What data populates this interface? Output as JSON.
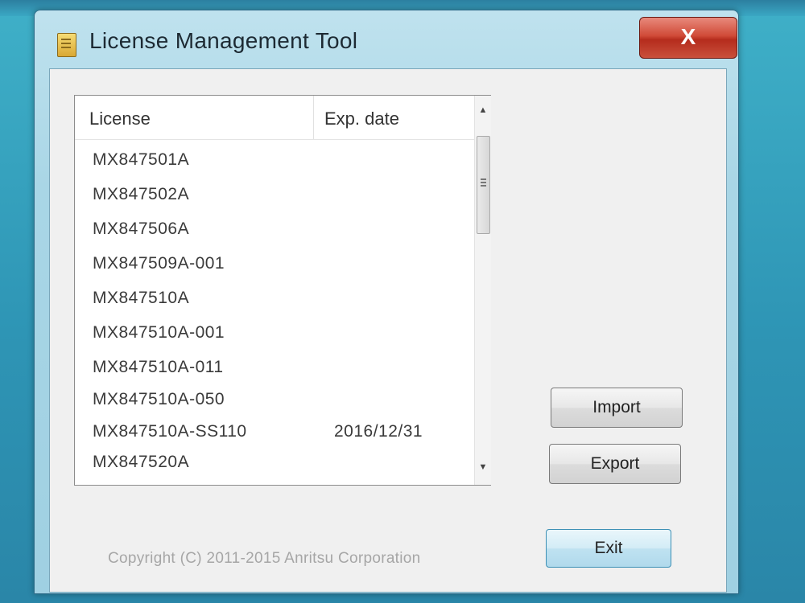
{
  "window": {
    "title": "License Management Tool",
    "close_label": "X"
  },
  "licenses": {
    "columns": [
      "License",
      "Exp. date"
    ],
    "rows": [
      {
        "license": "MX847501A",
        "exp": ""
      },
      {
        "license": "MX847502A",
        "exp": ""
      },
      {
        "license": "MX847506A",
        "exp": ""
      },
      {
        "license": "MX847509A-001",
        "exp": ""
      },
      {
        "license": "MX847510A",
        "exp": ""
      },
      {
        "license": "MX847510A-001",
        "exp": ""
      },
      {
        "license": "MX847510A-011",
        "exp": ""
      },
      {
        "license": "MX847510A-050",
        "exp": ""
      },
      {
        "license": "MX847510A-SS110",
        "exp": "2016/12/31"
      },
      {
        "license": "MX847520A",
        "exp": ""
      }
    ]
  },
  "buttons": {
    "import": "Import",
    "export": "Export",
    "exit": "Exit"
  },
  "footer": {
    "copyright": "Copyright (C) 2011-2015 Anritsu Corporation"
  },
  "icons": {
    "app": "document-icon",
    "scroll_up": "scroll-up-arrow-icon",
    "scroll_down": "scroll-down-arrow-icon"
  }
}
